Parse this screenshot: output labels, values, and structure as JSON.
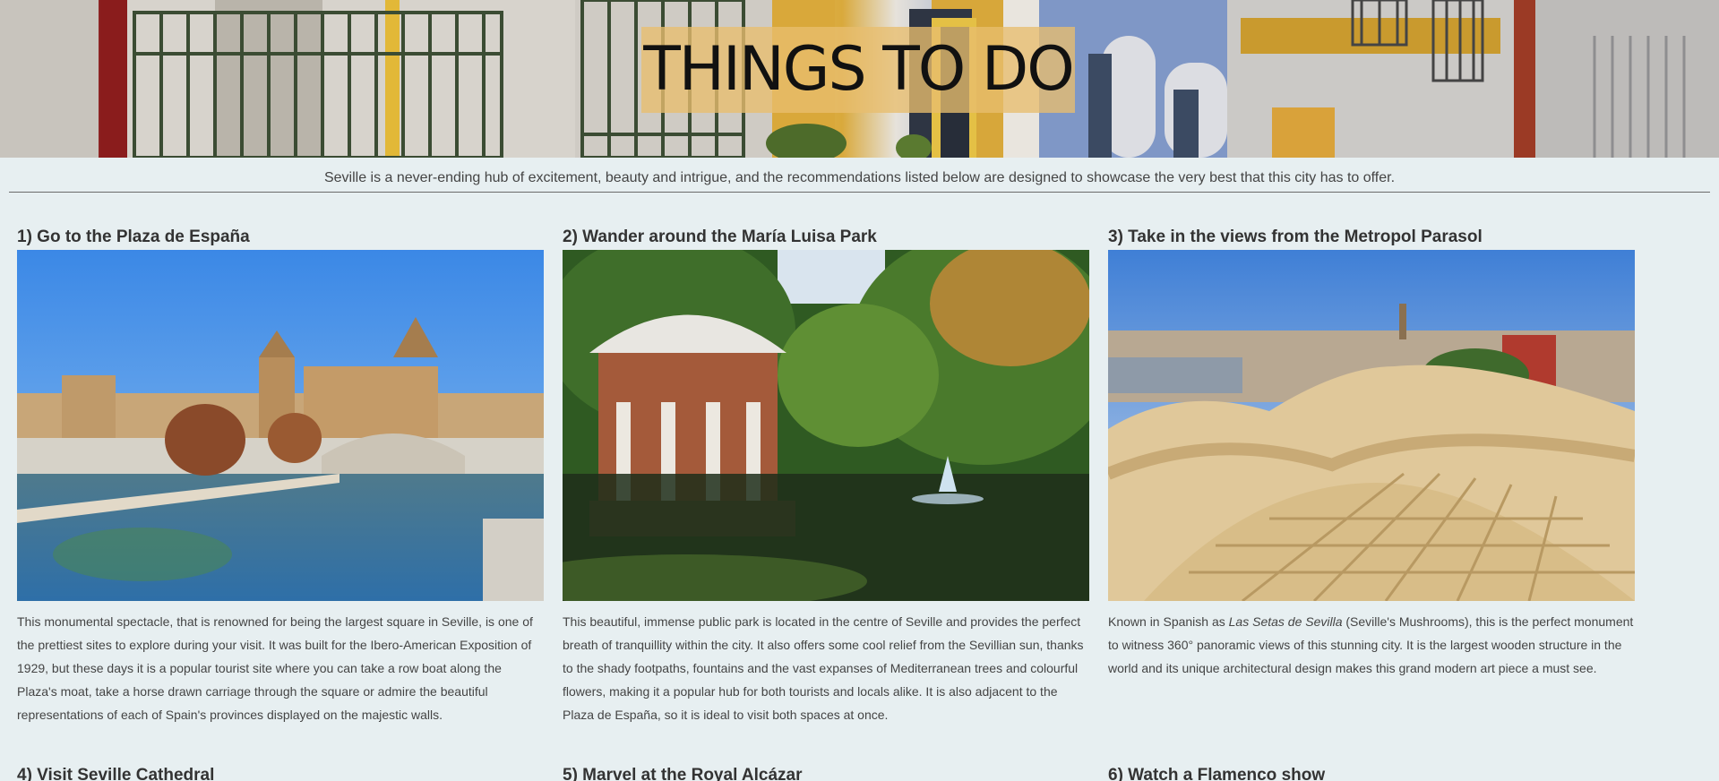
{
  "hero": {
    "title": "THINGS TO DO"
  },
  "intro": {
    "text": "Seville is a never-ending hub of excitement, beauty and intrigue, and the recommendations listed below are designed to showcase the very best that this city has to offer."
  },
  "activities": [
    {
      "title": "1) Go to the Plaza de España",
      "image": "plaza-de-espana-photo",
      "description": "This monumental spectacle, that is renowned for being the largest square in Seville, is one of the prettiest sites to explore during your visit. It was built for the Ibero-American Exposition of 1929, but these days it is a popular tourist site where you can take a row boat along the Plaza's moat, take a horse drawn carriage through the square or admire the beautiful representations of each of Spain's provinces displayed on the majestic walls."
    },
    {
      "title": "2) Wander around the María Luisa Park",
      "image": "maria-luisa-park-photo",
      "description": "This beautiful, immense public park is located in the centre of Seville and provides the perfect breath of tranquillity within the city. It also offers some cool relief from the Sevillian sun, thanks to the shady footpaths, fountains and the vast expanses of Mediterranean trees and colourful flowers, making it a popular hub for both tourists and locals alike. It is also adjacent to the Plaza de España, so it is ideal to visit both spaces at once."
    },
    {
      "title": "3) Take in the views from the Metropol Parasol",
      "image": "metropol-parasol-photo",
      "description_prefix": "Known in Spanish as ",
      "description_italic": "Las Setas de Sevilla",
      "description_suffix": " (Seville's Mushrooms), this is the perfect monument to witness 360° panoramic views of this stunning city. It is the largest wooden structure in the world and its unique architectural design makes this grand modern art piece a must see."
    },
    {
      "title": "4) Visit Seville Cathedral"
    },
    {
      "title": "5) Marvel at the Royal Alcázar"
    },
    {
      "title": "6) Watch a Flamenco show"
    }
  ],
  "colors": {
    "page_background": "#e7eff1",
    "title_box": "#e8be6e",
    "text": "#444444"
  }
}
